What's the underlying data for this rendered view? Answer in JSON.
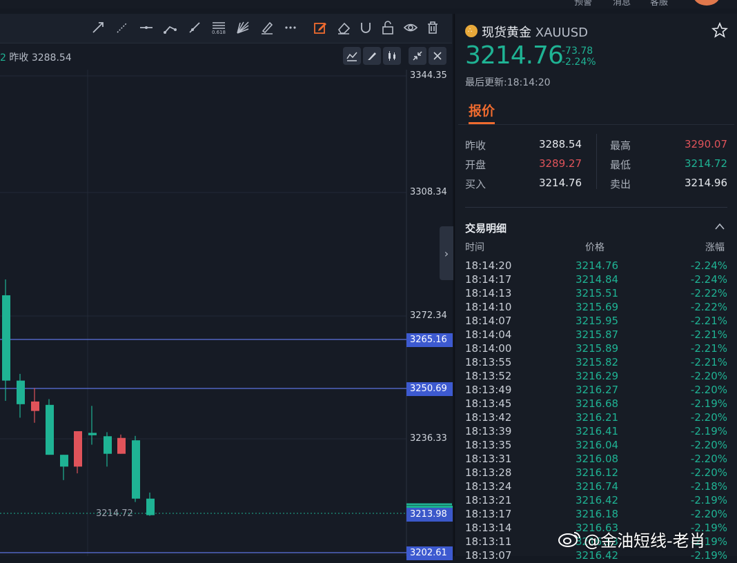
{
  "topbar": {
    "items": [
      "预警",
      "消息",
      "客服"
    ]
  },
  "chart": {
    "prev_close_label": "昨收 3288.54",
    "prev_close_prefix": "2",
    "axis_labels": [
      {
        "value": "3344.35",
        "color": "#e0535a"
      },
      {
        "value": "3308.34",
        "color": "#e0535a"
      },
      {
        "value": "3272.34",
        "color": "#1fb394"
      },
      {
        "value": "3236.33",
        "color": "#1fb394"
      }
    ],
    "hline_tags": [
      "3265.16",
      "3250.69",
      "3202.61"
    ],
    "current_price_tag": "3213.98",
    "low_marker": "3214.72",
    "colors": {
      "up": "#e0535a",
      "down": "#1fb394"
    }
  },
  "panel": {
    "name": "现货黄金",
    "symbol": "XAUUSD",
    "price": "3214.76",
    "change": "-73.78",
    "change_pct": "-2.24%",
    "updated": "最后更新:18:14:20",
    "tab": "报价",
    "quotes": {
      "prev_close_label": "昨收",
      "prev_close": "3288.54",
      "open_label": "开盘",
      "open": "3289.27",
      "bid_label": "买入",
      "bid": "3214.76",
      "high_label": "最高",
      "high": "3290.07",
      "low_label": "最低",
      "low": "3214.72",
      "ask_label": "卖出",
      "ask": "3214.96"
    },
    "trades_title": "交易明细",
    "headers": {
      "time": "时间",
      "price": "价格",
      "change": "涨幅"
    },
    "trades": [
      {
        "time": "18:14:20",
        "price": "3214.76",
        "change": "-2.24%"
      },
      {
        "time": "18:14:17",
        "price": "3214.84",
        "change": "-2.24%"
      },
      {
        "time": "18:14:13",
        "price": "3215.51",
        "change": "-2.22%"
      },
      {
        "time": "18:14:10",
        "price": "3215.69",
        "change": "-2.22%"
      },
      {
        "time": "18:14:07",
        "price": "3215.95",
        "change": "-2.21%"
      },
      {
        "time": "18:14:04",
        "price": "3215.87",
        "change": "-2.21%"
      },
      {
        "time": "18:14:00",
        "price": "3215.89",
        "change": "-2.21%"
      },
      {
        "time": "18:13:55",
        "price": "3215.82",
        "change": "-2.21%"
      },
      {
        "time": "18:13:52",
        "price": "3216.29",
        "change": "-2.20%"
      },
      {
        "time": "18:13:49",
        "price": "3216.27",
        "change": "-2.20%"
      },
      {
        "time": "18:13:45",
        "price": "3216.68",
        "change": "-2.19%"
      },
      {
        "time": "18:13:42",
        "price": "3216.21",
        "change": "-2.20%"
      },
      {
        "time": "18:13:39",
        "price": "3216.41",
        "change": "-2.19%"
      },
      {
        "time": "18:13:35",
        "price": "3216.04",
        "change": "-2.20%"
      },
      {
        "time": "18:13:31",
        "price": "3216.08",
        "change": "-2.20%"
      },
      {
        "time": "18:13:28",
        "price": "3216.12",
        "change": "-2.20%"
      },
      {
        "time": "18:13:24",
        "price": "3216.74",
        "change": "-2.18%"
      },
      {
        "time": "18:13:21",
        "price": "3216.42",
        "change": "-2.19%"
      },
      {
        "time": "18:13:17",
        "price": "3216.18",
        "change": "-2.20%"
      },
      {
        "time": "18:13:14",
        "price": "3216.63",
        "change": "-2.19%"
      },
      {
        "time": "18:13:11",
        "price": "3216.53",
        "change": "-2.19%"
      },
      {
        "time": "18:13:07",
        "price": "3216.42",
        "change": "-2.19%"
      }
    ]
  },
  "watermark": "@金油短线-老肖"
}
